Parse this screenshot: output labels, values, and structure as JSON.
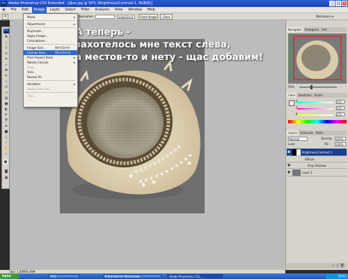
{
  "window": {
    "title": "Adobe Photoshop CS3 Extended - [Дно.jpg @ 50% (Brightness/Contrast 1, RGB/8)]"
  },
  "menu": [
    "File",
    "Edit",
    "Image",
    "Layer",
    "Select",
    "Filter",
    "Analysis",
    "View",
    "Window",
    "Help"
  ],
  "options_bar": {
    "resolution_label": "Resolution:",
    "resolution_unit": "pixels/inch",
    "front_image_button": "Front Image",
    "clear_button": "Clear",
    "workspace_label": "Workspace ▾"
  },
  "image_menu": {
    "items": [
      {
        "label": "Mode",
        "arrow": "▸"
      },
      {
        "label": "Adjustments",
        "arrow": "▸"
      },
      {
        "label": "Duplicate..."
      },
      {
        "label": "Apply Image..."
      },
      {
        "label": "Calculations..."
      },
      {
        "label": "Image Size...",
        "shortcut": "Alt+Ctrl+I"
      },
      {
        "label": "Canvas Size...",
        "shortcut": "Alt+Ctrl+C"
      },
      {
        "label": "Pixel Aspect Ratio",
        "arrow": "▸"
      },
      {
        "label": "Rotate Canvas",
        "arrow": "▸"
      },
      {
        "label": "Crop"
      },
      {
        "label": "Trim..."
      },
      {
        "label": "Reveal All"
      },
      {
        "label": "Variables",
        "arrow": "▸"
      },
      {
        "label": "Apply Data Set..."
      },
      {
        "label": "Trap..."
      }
    ]
  },
  "overlay_text": {
    "line1": "А теперь  -",
    "line2": "захотелось мне текст слева,",
    "line3": "а местов-то и нету - щас добавим!"
  },
  "navigator": {
    "tabs": [
      "Navigator",
      "Histogram",
      "Info"
    ],
    "zoom": "50%"
  },
  "color_panel": {
    "tabs": [
      "Color",
      "Swatches",
      "Styles"
    ],
    "channels": [
      {
        "label": "R",
        "value": "255"
      },
      {
        "label": "G",
        "value": "255"
      },
      {
        "label": "B",
        "value": "255"
      }
    ]
  },
  "layers_panel": {
    "tabs": [
      "Layers",
      "Channels",
      "Paths"
    ],
    "blend_mode": "Normal",
    "opacity_label": "Opacity:",
    "opacity_value": "100%",
    "lock_label": "Lock:",
    "fill_label": "Fill:",
    "fill_value": "100%",
    "layers": [
      {
        "name": "Brightness/Contrast 1"
      },
      {
        "name": "Effects"
      },
      {
        "name": "Drop Shadow"
      },
      {
        "name": "Layer 1"
      }
    ]
  },
  "status": {
    "text": "Doc: 1,40M/4,46M"
  },
  "taskbar": {
    "start": "пуск",
    "tasks": [
      "ICQ",
      "В Контакте | Фотограф...",
      "Adobe Photoshop CS3 ..."
    ],
    "clock": "18:42"
  },
  "colors": {
    "titlebar": "#2a5bd7",
    "menu_highlight": "#3169c6",
    "workspace": "#bcbcbc",
    "document_bg": "#6f6f6f",
    "layer_selected": "#1c3f8f"
  },
  "icons": [
    "ps-logo-icon",
    "move-icon",
    "marquee-icon",
    "lasso-icon",
    "magic-wand-icon",
    "crop-icon",
    "eyedropper-icon",
    "healing-icon",
    "brush-icon",
    "stamp-icon",
    "history-brush-icon",
    "eraser-icon",
    "gradient-icon",
    "blur-icon",
    "dodge-icon",
    "pen-icon",
    "type-icon",
    "path-select-icon",
    "shape-icon",
    "notes-icon",
    "eyedropper2-icon",
    "hand-icon",
    "zoom-icon",
    "eye-icon"
  ]
}
